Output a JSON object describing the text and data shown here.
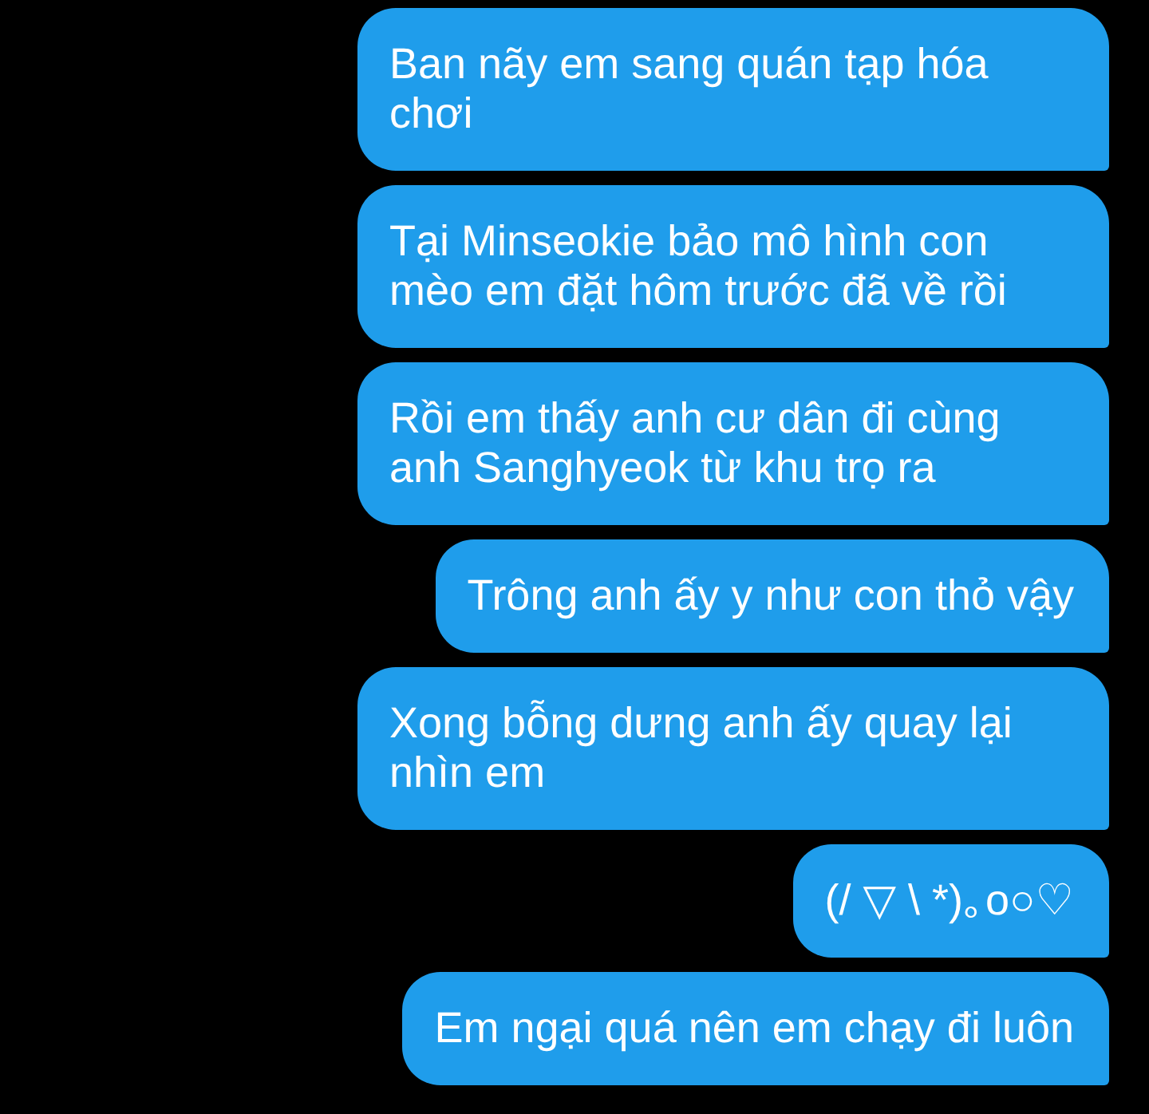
{
  "messages": [
    {
      "text": "Ban nãy em sang quán tạp hóa chơi"
    },
    {
      "text": "Tại Minseokie bảo mô hình con mèo em đặt hôm trước đã về rồi"
    },
    {
      "text": "Rồi em thấy anh cư dân đi cùng anh Sanghyeok từ khu trọ ra"
    },
    {
      "text": "Trông anh ấy y như con thỏ vậy"
    },
    {
      "text": "Xong bỗng dưng anh ấy quay lại nhìn em"
    },
    {
      "text": "(/ ▽ \\ *)｡o○♡"
    },
    {
      "text": "Em ngại quá nên em chạy đi luôn"
    }
  ]
}
